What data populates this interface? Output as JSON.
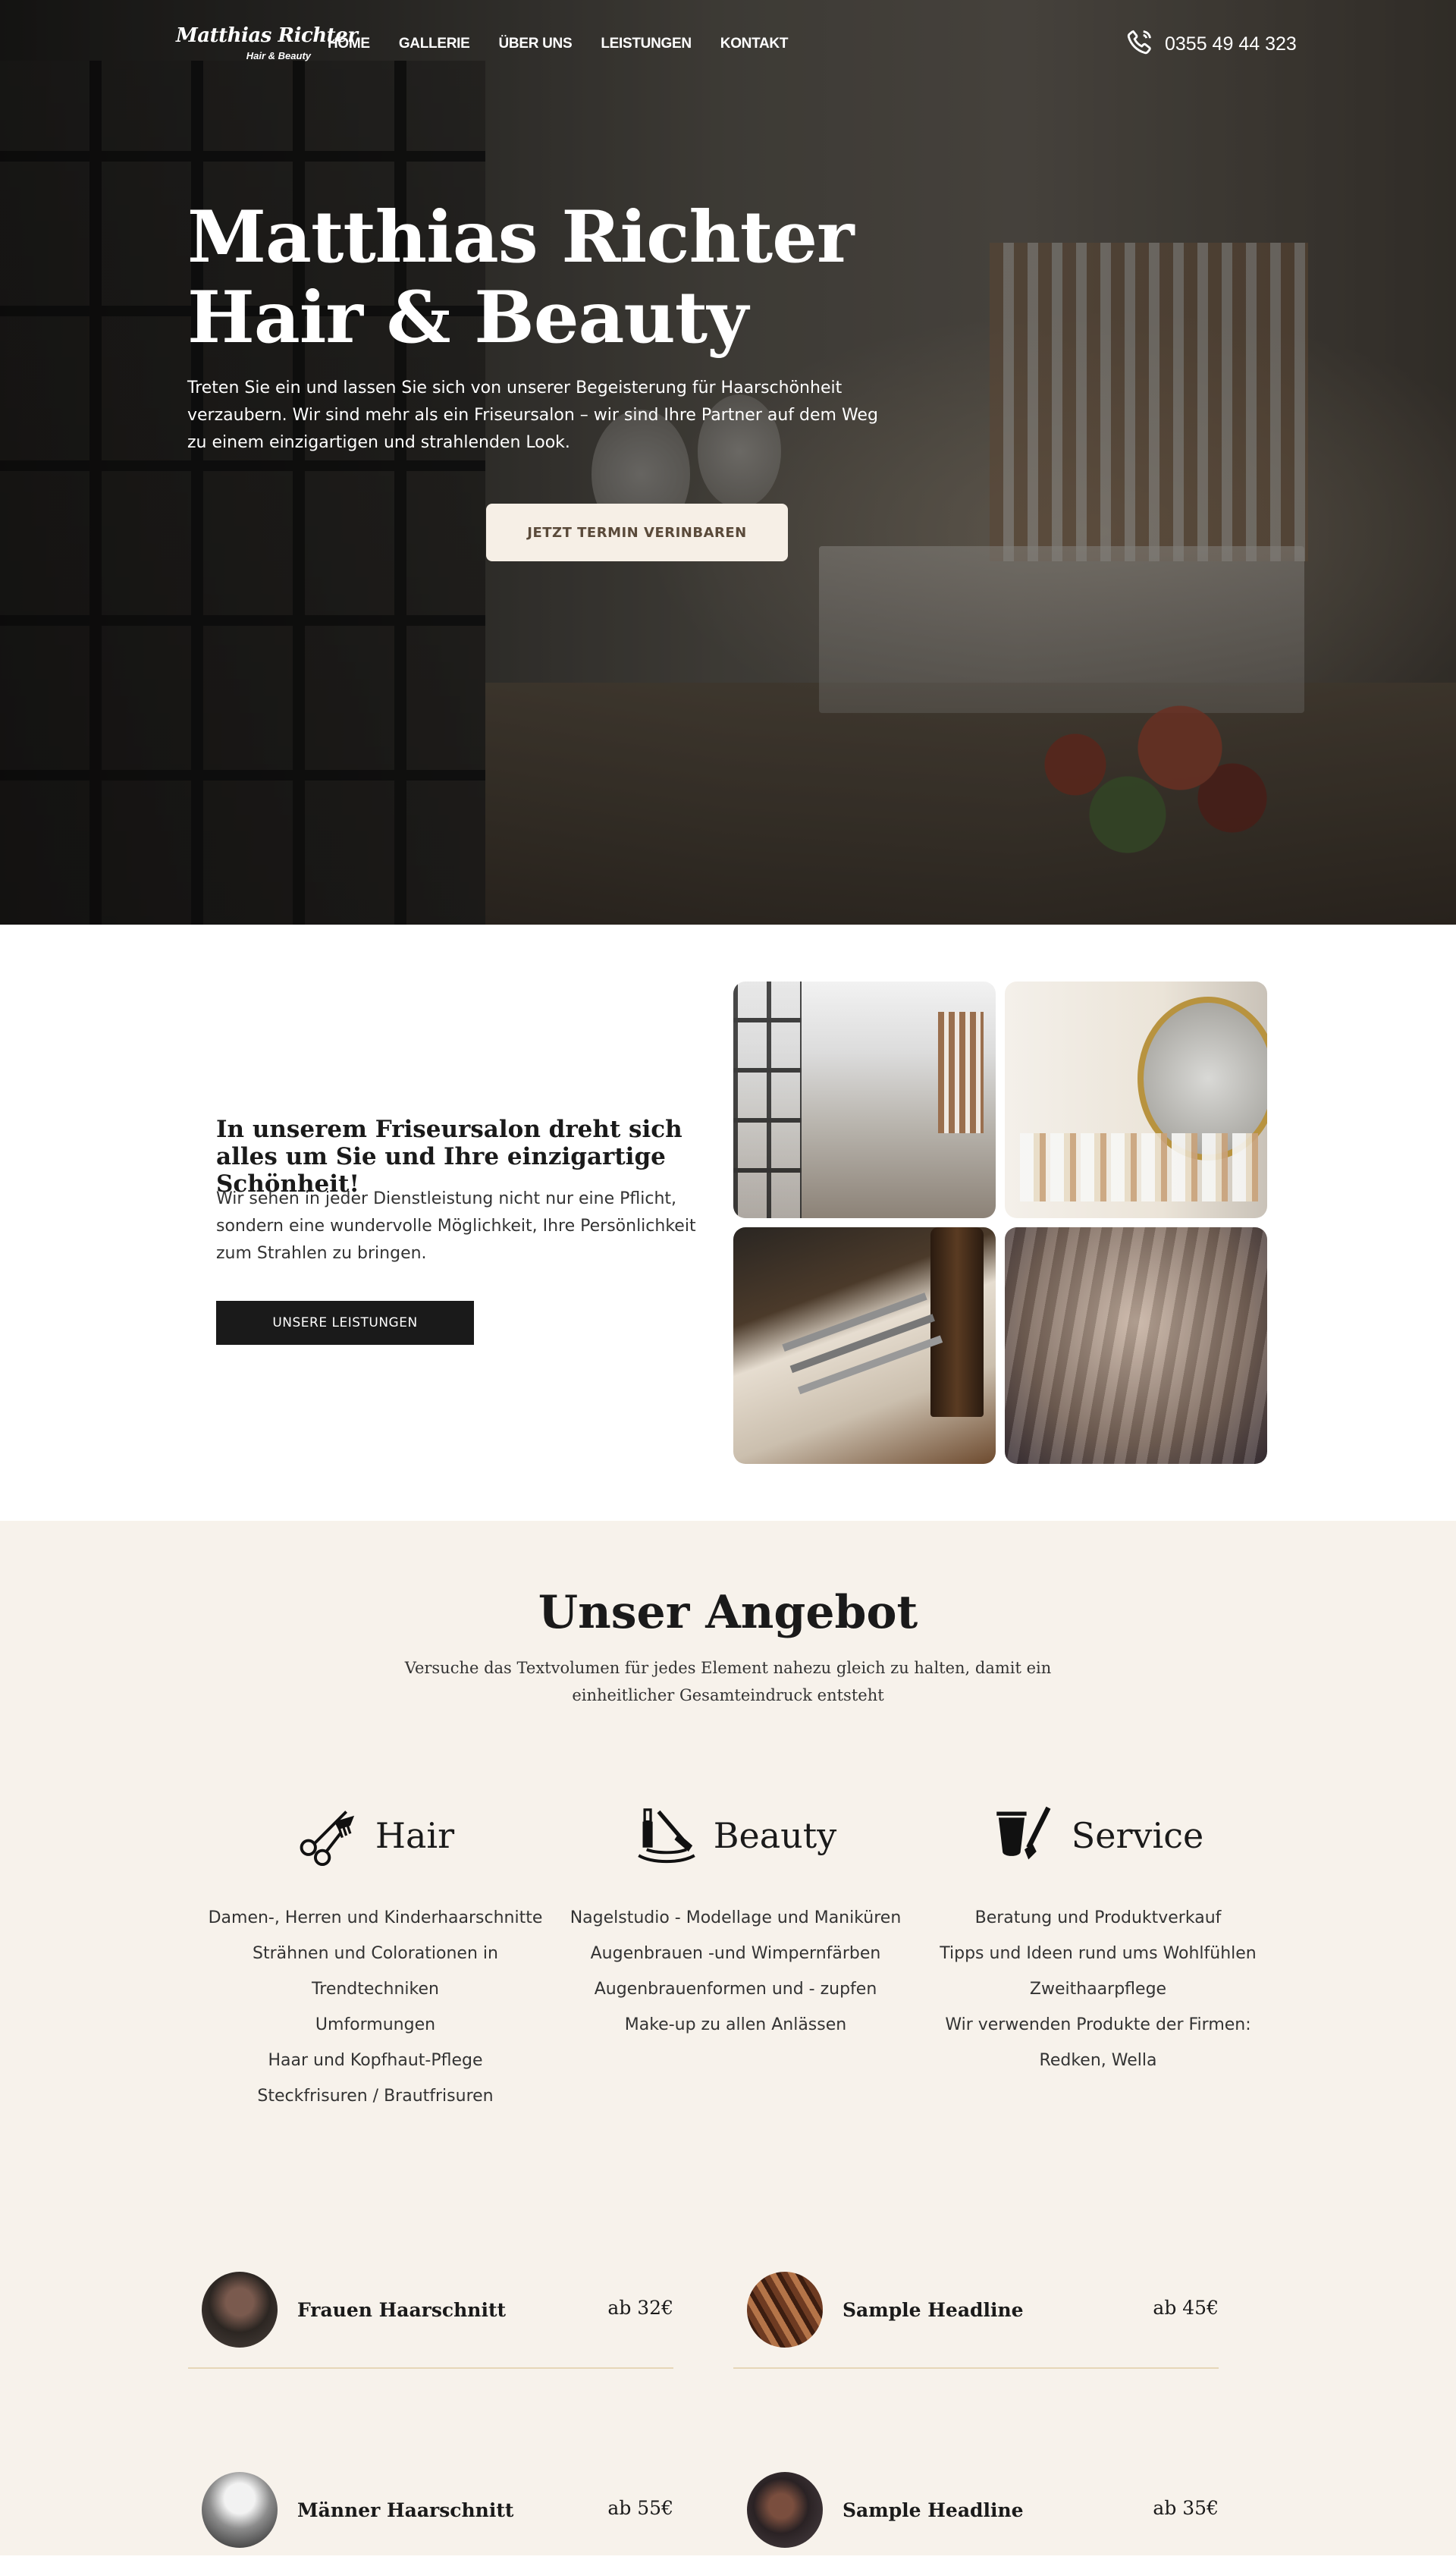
{
  "header": {
    "logo_main": "Matthias Richter",
    "logo_sub": "Hair & Beauty",
    "nav": [
      "HOME",
      "GALLERIE",
      "ÜBER UNS",
      "LEISTUNGEN",
      "KONTAKT"
    ],
    "phone": "0355 49 44 323"
  },
  "hero": {
    "title_line1": "Matthias Richter",
    "title_line2": "Hair & Beauty",
    "text": "Treten Sie ein und lassen Sie sich von unserer Begeisterung für Haarschönheit verzaubern. Wir sind mehr als ein Friseursalon – wir sind Ihre Partner auf dem Weg zu einem einzigartigen und strahlenden Look.",
    "button": "JETZT TERMIN VERINBAREN"
  },
  "intro": {
    "heading": "In unserem Friseursalon dreht sich alles um Sie und Ihre einzigartige Schönheit!",
    "text": "Wir sehen in jeder Dienstleistung nicht nur eine Pflicht, sondern eine wundervolle Möglichkeit, Ihre Persönlichkeit zum Strahlen zu bringen.",
    "button": "UNSERE LEISTUNGEN"
  },
  "offer": {
    "title": "Unser Angebot",
    "subtitle": "Versuche das Textvolumen für jedes Element nahezu gleich zu halten, damit ein einheitlicher Gesamteindruck entsteht",
    "columns": [
      {
        "title": "Hair",
        "icon": "scissors-comb-icon",
        "items": [
          "Damen-, Herren und Kinderhaarschnitte",
          "Strähnen und Colorationen in",
          "Trendtechniken",
          "Umformungen",
          "Haar und Kopfhaut-Pflege",
          "Steckfrisuren / Brautfrisuren"
        ]
      },
      {
        "title": "Beauty",
        "icon": "makeup-icon",
        "items": [
          "Nagelstudio - Modellage und Maniküren",
          "Augenbrauen -und Wimpernfärben",
          "Augenbrauenformen und - zupfen",
          "Make-up zu allen Anlässen"
        ]
      },
      {
        "title": "Service",
        "icon": "hair-color-brush-icon",
        "items": [
          "Beratung und Produktverkauf",
          "Tipps und Ideen rund ums Wohlfühlen",
          "Zweithaarpflege",
          "Wir verwenden Produkte der Firmen:",
          "Redken, Wella"
        ]
      }
    ],
    "prices": [
      {
        "name": "Frauen Haarschnitt",
        "price": "ab 32€"
      },
      {
        "name": "Sample Headline",
        "price": "ab 45€"
      },
      {
        "name": "Männer Haarschnitt",
        "price": "ab 55€"
      },
      {
        "name": "Sample Headline",
        "price": "ab 35€"
      }
    ]
  },
  "colors": {
    "offer_bg": "#f7f2eb",
    "button_dark": "#1a1a1a",
    "hero_button_bg": "#f6efe6",
    "divider": "#e6d6b8"
  }
}
